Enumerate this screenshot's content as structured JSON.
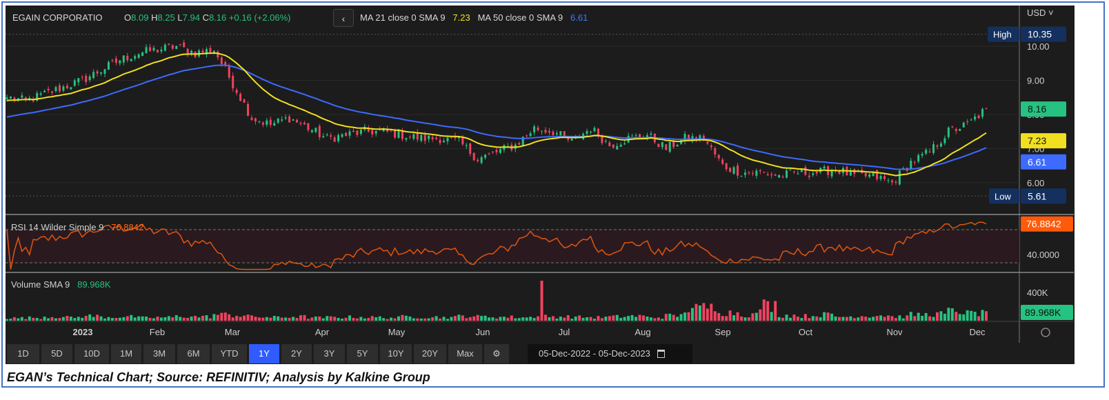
{
  "header": {
    "symbol": "EGAIN CORPORATIO",
    "open_label": "O",
    "open": "8.09",
    "high_label": "H",
    "high": "8.25",
    "low_label": "L",
    "low": "7.94",
    "close_label": "C",
    "close": "8.16",
    "change": "+0.16 (+2.06%)",
    "back": "‹",
    "ma1_label": "MA 21 close 0 SMA 9",
    "ma1_value": "7.23",
    "ma2_label": "MA 50 close 0 SMA 9",
    "ma2_value": "6.61"
  },
  "axis": {
    "currency": "USD ˅",
    "ticks": [
      "10.00",
      "9.00",
      "8.00",
      "7.00",
      "6.00"
    ],
    "high_label": "High",
    "high_value": "10.35",
    "low_label": "Low",
    "low_value": "5.61",
    "last_badge": "8.16",
    "ma1_badge": "7.23",
    "ma2_badge": "6.61"
  },
  "rsi": {
    "label": "RSI 14 Wilder Simple 9",
    "value": "76.8842",
    "tick": "40.0000"
  },
  "volume": {
    "label": "Volume SMA 9",
    "value": "89.968K",
    "tick": "400K",
    "badge": "89.968K"
  },
  "time_axis": [
    "2023",
    "Feb",
    "Mar",
    "Apr",
    "May",
    "Jun",
    "Jul",
    "Aug",
    "Sep",
    "Oct",
    "Nov",
    "Dec"
  ],
  "periods": [
    "1D",
    "5D",
    "10D",
    "1M",
    "3M",
    "6M",
    "YTD",
    "1Y",
    "2Y",
    "3Y",
    "5Y",
    "10Y",
    "20Y",
    "Max"
  ],
  "active_period": "1Y",
  "date_range": {
    "from": "05-Dec-2022",
    "sep": "-",
    "to": "05-Dec-2023"
  },
  "caption": "EGAN’s Technical Chart; Source: REFINITIV; Analysis by Kalkine Group",
  "colors": {
    "up": "#26c281",
    "down": "#f0435f",
    "ma21": "#f0e020",
    "ma50": "#3d6bff",
    "rsi": "#e0560f",
    "high_low_badge": "#14305f"
  },
  "chart_data": {
    "type": "candlestick",
    "title": "EGAIN CORPORATIO",
    "x_range": [
      "05-Dec-2022",
      "05-Dec-2023"
    ],
    "ylim": [
      5.3,
      10.7
    ],
    "weekly_close": [
      8.5,
      8.4,
      8.6,
      8.8,
      9.0,
      9.3,
      9.6,
      9.8,
      9.9,
      10.0,
      9.8,
      9.9,
      8.9,
      7.9,
      7.7,
      7.9,
      7.6,
      7.3,
      7.4,
      7.5,
      7.5,
      7.4,
      7.3,
      7.3,
      7.2,
      6.7,
      6.9,
      7.1,
      7.6,
      7.5,
      7.2,
      7.6,
      7.1,
      7.3,
      7.4,
      7.0,
      7.3,
      7.3,
      6.5,
      6.3,
      6.3,
      6.2,
      6.3,
      6.3,
      6.4,
      6.2,
      6.2,
      6.0,
      6.6,
      6.9,
      7.5,
      7.7,
      8.16
    ],
    "weekly_volume_k": [
      40,
      45,
      60,
      50,
      70,
      55,
      60,
      45,
      50,
      65,
      60,
      90,
      80,
      55,
      50,
      60,
      45,
      50,
      55,
      50,
      45,
      60,
      55,
      50,
      70,
      60,
      55,
      50,
      520,
      60,
      55,
      50,
      60,
      70,
      50,
      75,
      180,
      200,
      120,
      90,
      230,
      80,
      70,
      90,
      60,
      70,
      80,
      60,
      90,
      100,
      140,
      110,
      160
    ],
    "rsi_ylim": [
      20,
      80
    ],
    "rsi_bands": [
      30,
      70
    ],
    "volume_ylim": [
      0,
      560
    ]
  }
}
